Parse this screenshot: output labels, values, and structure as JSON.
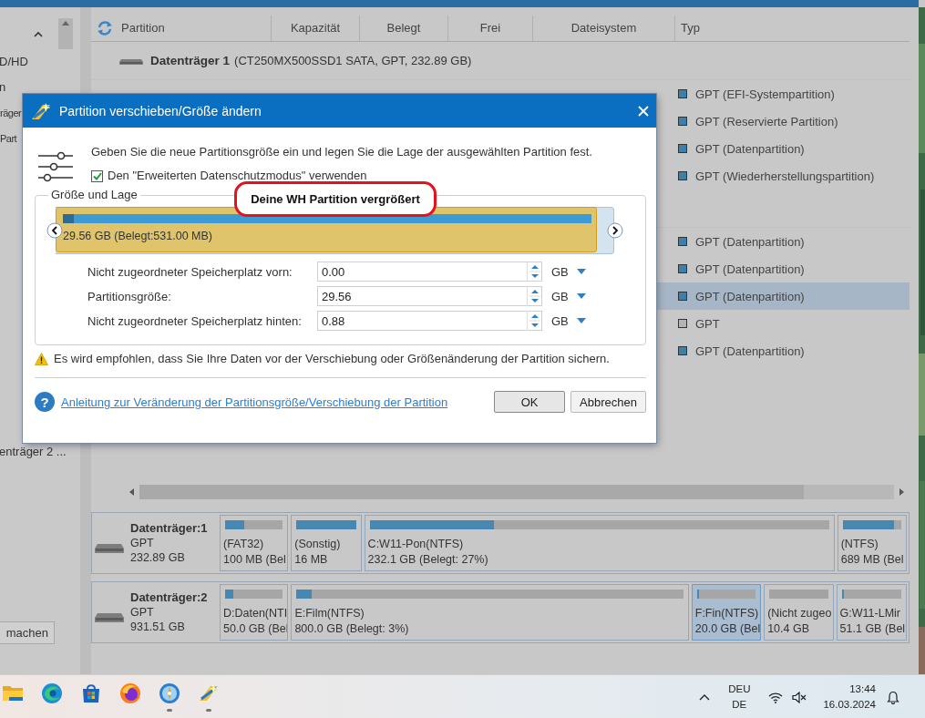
{
  "sidebar": {
    "items": [
      "D/HD",
      "n",
      "räger",
      "Part",
      "enträger 2 ..."
    ],
    "button": "machen"
  },
  "table": {
    "columns": [
      "Partition",
      "Kapazität",
      "Belegt",
      "Frei",
      "Dateisystem",
      "Typ"
    ],
    "groups": [
      {
        "disk": {
          "name": "Datenträger 1",
          "details": "(CT250MX500SSD1 SATA, GPT, 232.89 GB)"
        },
        "rows": [
          {
            "type": "GPT (EFI-Systempartition)",
            "color": "#3f7ea9",
            "selected": false
          },
          {
            "type": "GPT (Reservierte Partition)",
            "color": "#3f7ea9",
            "selected": false
          },
          {
            "type": "GPT (Datenpartition)",
            "color": "#3f7ea9",
            "selected": false
          },
          {
            "type": "GPT (Wiederherstellungspartition)",
            "color": "#3f7ea9",
            "selected": false
          }
        ]
      },
      {
        "rows": [
          {
            "type": "GPT (Datenpartition)",
            "color": "#3f7ea9",
            "selected": false
          },
          {
            "type": "GPT (Datenpartition)",
            "color": "#3f7ea9",
            "selected": false
          },
          {
            "type": "GPT (Datenpartition)",
            "color": "#3f7ea9",
            "selected": true
          },
          {
            "type": "GPT",
            "color": "#b4b4b4",
            "selected": false
          },
          {
            "type": "GPT (Datenpartition)",
            "color": "#3f7ea9",
            "selected": false
          }
        ]
      }
    ]
  },
  "disk_map": [
    {
      "name": "Datenträger:1",
      "scheme": "GPT",
      "size": "232.89 GB",
      "partitions": [
        {
          "label": "(FAT32)",
          "detail": "100 MB (Bel",
          "level": 0.33,
          "selected": false
        },
        {
          "label": "(Sonstig)",
          "detail": "16 MB",
          "level": 1,
          "selected": false
        },
        {
          "label": "C:W11-Pon(NTFS)",
          "detail": "232.1 GB (Belegt: 27%)",
          "level": 0.27,
          "selected": false
        },
        {
          "label": "(NTFS)",
          "detail": "689 MB (Bel",
          "level": 0.87,
          "selected": false
        }
      ]
    },
    {
      "name": "Datenträger:2",
      "scheme": "GPT",
      "size": "931.51 GB",
      "partitions": [
        {
          "label": "D:Daten(NTI",
          "detail": "50.0 GB (Bel",
          "level": 0.14,
          "selected": false
        },
        {
          "label": "E:Film(NTFS)",
          "detail": "800.0 GB (Belegt: 3%)",
          "level": 0.04,
          "selected": false
        },
        {
          "label": "F:Fin(NTFS)",
          "detail": "20.0 GB (Bel",
          "level": 0.03,
          "selected": true
        },
        {
          "kind": "unallocated",
          "label": "(Nicht zugeo",
          "detail": "10.4 GB",
          "selected": false
        },
        {
          "label": "G:W11-LMir",
          "detail": "51.1 GB (Bel",
          "level": 0.03,
          "selected": false
        }
      ]
    }
  ],
  "dialog": {
    "title": "Partition verschieben/Größe ändern",
    "intro": "Geben Sie die neue Partitionsgröße ein und legen Sie die Lage der ausgewählten Partition fest.",
    "checkbox": {
      "label": "Den \"Erweiterten Datenschutzmodus\" verwenden",
      "checked": true
    },
    "group_title": "Größe und Lage",
    "partition_map": {
      "label": "29.56 GB (Belegt:531.00 MB)",
      "level": 0.97,
      "used": {
        "level": 0.02
      }
    },
    "fields": [
      {
        "label": "Nicht zugeordneter Speicherplatz vorn:",
        "value": "0.00",
        "unit": "GB"
      },
      {
        "label": "Partitionsgröße:",
        "value": "29.56",
        "unit": "GB"
      },
      {
        "label": "Nicht zugeordneter Speicherplatz hinten:",
        "value": "0.88",
        "unit": "GB"
      }
    ],
    "warning": "Es wird empfohlen, dass Sie Ihre Daten vor der Verschiebung oder Größenänderung der Partition sichern.",
    "help_icon": "?",
    "help_link": "Anleitung zur Veränderung der Partitionsgröße/Verschiebung der Partition",
    "buttons": [
      "OK",
      "Abbrechen"
    ]
  },
  "annotation": "Deine WH Partition vergrößert",
  "taskbar": {
    "apps": [
      {
        "kind": "folder",
        "running": false
      },
      {
        "kind": "edge",
        "running": false
      },
      {
        "kind": "store",
        "running": false
      },
      {
        "kind": "firefox",
        "running": false
      },
      {
        "kind": "compass",
        "running": true
      },
      {
        "kind": "wizard",
        "running": true
      }
    ],
    "language": "DEU",
    "layout": "DE",
    "time": "13:44",
    "date": "16.03.2024"
  }
}
